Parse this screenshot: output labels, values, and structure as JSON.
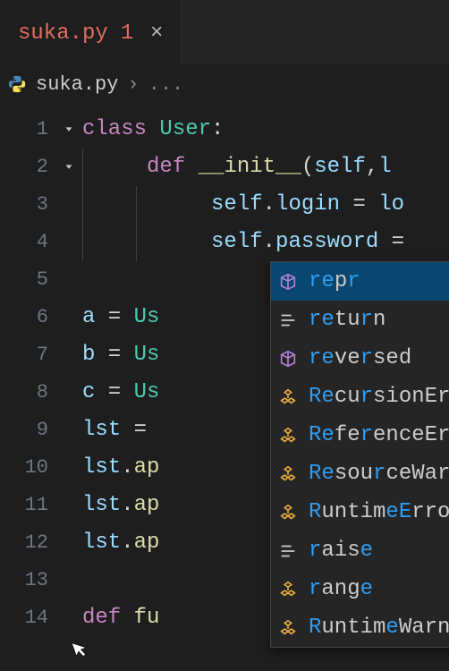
{
  "tab": {
    "filename": "suka.py",
    "dirty_indicator": "1",
    "close_label": "×"
  },
  "breadcrumb": {
    "filename": "suka.py",
    "more": "..."
  },
  "gutter": [
    "1",
    "2",
    "3",
    "4",
    "5",
    "6",
    "7",
    "8",
    "9",
    "10",
    "11",
    "12",
    "13",
    "14"
  ],
  "code": {
    "l1": {
      "kw": "class",
      "name": "User",
      "colon": ":"
    },
    "l2": {
      "kw": "def",
      "name": "__init__",
      "open": "(",
      "p1": "self",
      "comma": ",",
      "p2": "l"
    },
    "l3": {
      "self": "self",
      "dot": ".",
      "attr": "login",
      "eq": " = ",
      "rhs": "lo"
    },
    "l4": {
      "self": "self",
      "dot": ".",
      "attr": "password",
      "eq": " ="
    },
    "l6": {
      "v": "a",
      "eq": " = ",
      "cls": "Us"
    },
    "l7": {
      "v": "b",
      "eq": " = ",
      "cls": "Us"
    },
    "l8": {
      "v": "c",
      "eq": " = ",
      "cls": "Us"
    },
    "l9": {
      "v": "lst",
      "eq": " = "
    },
    "l10": {
      "v": "lst",
      "dot": ".",
      "m": "ap"
    },
    "l11": {
      "v": "lst",
      "dot": ".",
      "m": "ap"
    },
    "l12": {
      "v": "lst",
      "dot": ".",
      "m": "ap"
    },
    "l14": {
      "kw": "def",
      "name": "fu"
    }
  },
  "autocomplete": {
    "items": [
      {
        "icon": "cube",
        "pre": "",
        "hl": "re",
        "mid": "p",
        "hl2": "r",
        "post": ""
      },
      {
        "icon": "snippet",
        "pre": "",
        "hl": "re",
        "mid": "tu",
        "hl2": "r",
        "post": "n"
      },
      {
        "icon": "cube",
        "pre": "",
        "hl": "re",
        "mid": "ve",
        "hl2": "r",
        "post": "sed"
      },
      {
        "icon": "class",
        "pre": "",
        "hl": "Re",
        "mid": "cu",
        "hl2": "r",
        "post": "sionError"
      },
      {
        "icon": "class",
        "pre": "",
        "hl": "Re",
        "mid": "fe",
        "hl2": "r",
        "post": "enceError"
      },
      {
        "icon": "class",
        "pre": "",
        "hl": "Re",
        "mid": "sou",
        "hl2": "r",
        "post": "ceWarnin"
      },
      {
        "icon": "class",
        "pre": "",
        "hl": "R",
        "mid": "untim",
        "hl2": "eE",
        "post": "rror"
      },
      {
        "icon": "snippet",
        "pre": "",
        "hl": "r",
        "mid": "ais",
        "hl2": "e",
        "post": ""
      },
      {
        "icon": "class",
        "pre": "",
        "hl": "r",
        "mid": "ang",
        "hl2": "e",
        "post": ""
      },
      {
        "icon": "class",
        "pre": "",
        "hl": "R",
        "mid": "untim",
        "hl2": "e",
        "post": "Warning"
      }
    ]
  }
}
